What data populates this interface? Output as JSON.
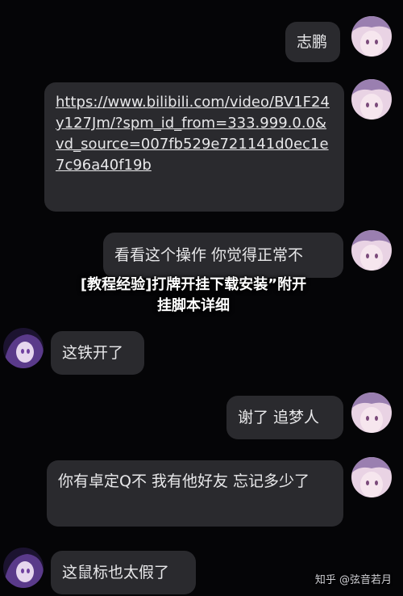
{
  "messages": [
    {
      "text": "志鹏"
    },
    {
      "text": "https://www.bilibili.com/video/BV1F24y127Jm/?spm_id_from=333.999.0.0&vd_source=007fb529e721141d0ec1e7c96a40f19b"
    },
    {
      "text": "看看这个操作 你觉得正常不"
    },
    {
      "text": "这铁开了"
    },
    {
      "text": "谢了 追梦人"
    },
    {
      "text": "你有卓定Q不 我有他好友 忘记多少了"
    },
    {
      "text": "这鼠标也太假了"
    }
  ],
  "overlay": {
    "line1": "[教程经验]打牌开挂下载安装”附开",
    "line2": "挂脚本详细"
  },
  "watermark": "知乎 @弦音若月",
  "colors": {
    "background": "#050507",
    "bubble": "#2a2a2e",
    "text": "#e8e8ea"
  }
}
